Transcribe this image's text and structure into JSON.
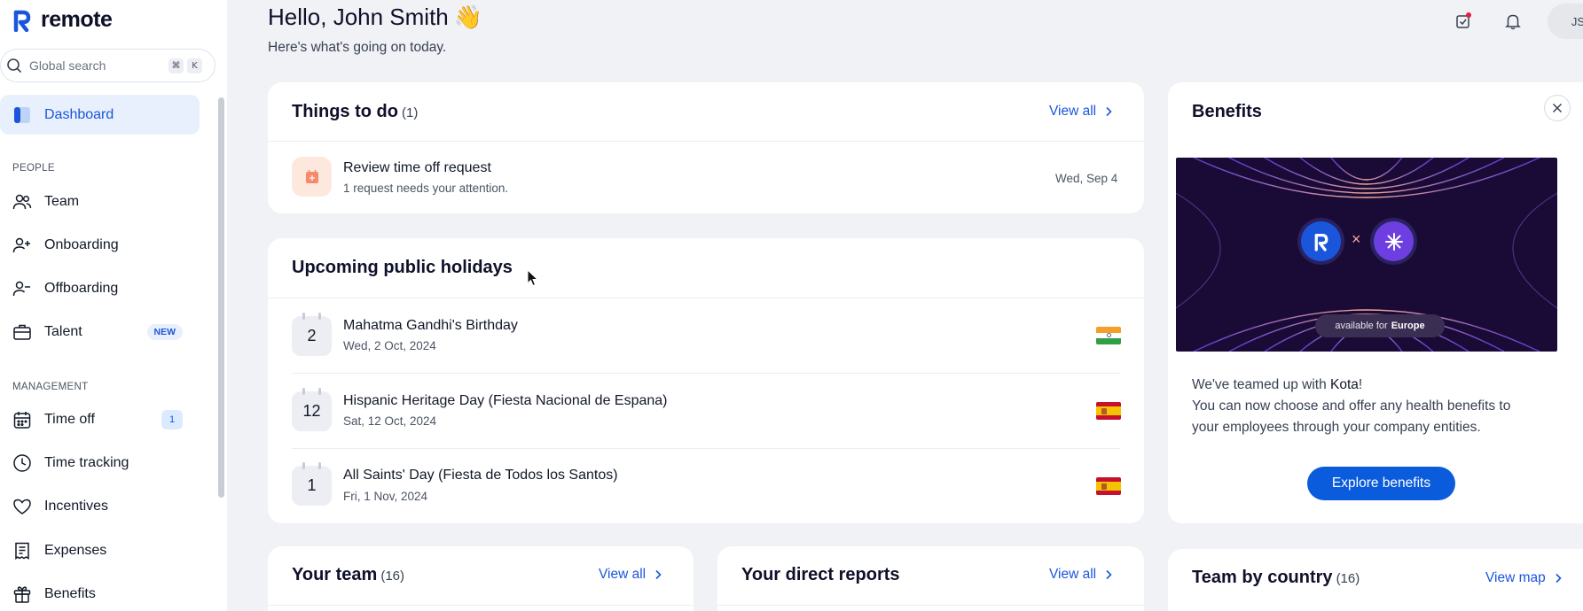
{
  "app": {
    "name": "remote"
  },
  "search": {
    "placeholder": "Global search",
    "shortcut": [
      "⌘",
      "K"
    ]
  },
  "sidebar": {
    "active": {
      "label": "Dashboard",
      "icon": "dashboard-icon"
    },
    "sections": [
      {
        "title": "PEOPLE",
        "items": [
          {
            "label": "Team",
            "icon": "team-icon"
          },
          {
            "label": "Onboarding",
            "icon": "user-plus-icon"
          },
          {
            "label": "Offboarding",
            "icon": "user-minus-icon"
          },
          {
            "label": "Talent",
            "icon": "briefcase-icon",
            "badge": "NEW"
          }
        ]
      },
      {
        "title": "MANAGEMENT",
        "items": [
          {
            "label": "Time off",
            "icon": "calendar-icon",
            "badge": "1"
          },
          {
            "label": "Time tracking",
            "icon": "clock-icon"
          },
          {
            "label": "Incentives",
            "icon": "heart-icon"
          },
          {
            "label": "Expenses",
            "icon": "receipt-icon"
          },
          {
            "label": "Benefits",
            "icon": "gift-icon"
          }
        ]
      }
    ]
  },
  "header": {
    "greeting": "Hello, John Smith",
    "emoji": "👋",
    "subtitle": "Here's what's going on today.",
    "avatar_initials": "JS"
  },
  "todo": {
    "title": "Things to do",
    "count": "(1)",
    "view_all": "View all",
    "items": [
      {
        "title": "Review time off request",
        "subtitle": "1 request needs your attention.",
        "date": "Wed, Sep 4"
      }
    ]
  },
  "holidays": {
    "title": "Upcoming public holidays",
    "items": [
      {
        "day": "2",
        "name": "Mahatma Gandhi's Birthday",
        "date": "Wed, 2 Oct, 2024",
        "flag": "india-flag"
      },
      {
        "day": "12",
        "name": "Hispanic Heritage Day (Fiesta Nacional de Espana)",
        "date": "Sat, 12 Oct, 2024",
        "flag": "spain-flag"
      },
      {
        "day": "1",
        "name": "All Saints' Day (Fiesta de Todos los Santos)",
        "date": "Fri, 1 Nov, 2024",
        "flag": "spain-flag"
      }
    ]
  },
  "benefits": {
    "title": "Benefits",
    "promo_pill_prefix": "available for",
    "promo_pill_region": "Europe",
    "promo_separator": "×",
    "line1_prefix": "We've teamed up with ",
    "line1_brand": "Kota",
    "line1_suffix": "!",
    "line2": "You can now choose and offer any health benefits to",
    "line3": "your employees through your company entities.",
    "cta": "Explore benefits"
  },
  "your_team": {
    "title": "Your team",
    "count": "(16)",
    "view_all": "View all"
  },
  "direct_reports": {
    "title": "Your direct reports",
    "view_all": "View all"
  },
  "team_by_country": {
    "title": "Team by country",
    "count": "(16)",
    "view_all": "View map"
  },
  "colors": {
    "accent": "#1a56db",
    "cta": "#0b5cdc",
    "promo_bg": "#1a0b36",
    "app_bg": "#f1f2f6"
  }
}
